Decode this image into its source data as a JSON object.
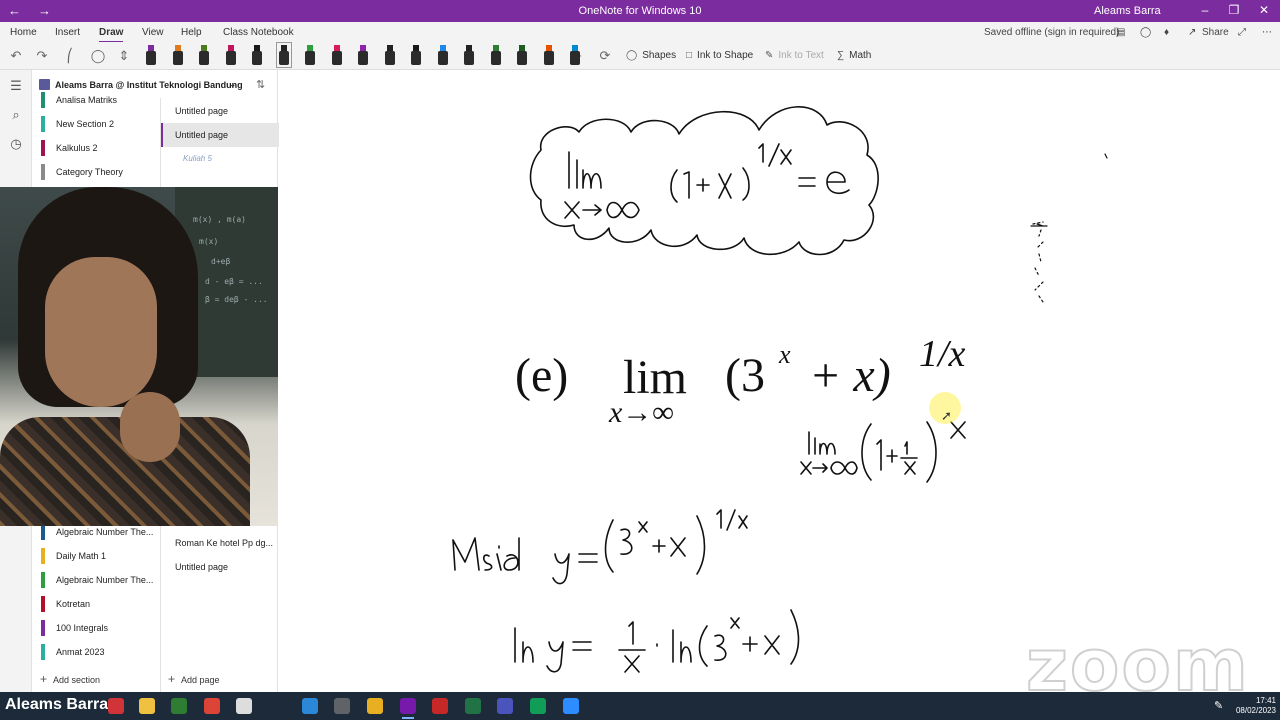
{
  "window": {
    "title": "OneNote for Windows 10",
    "user": "Aleams Barra",
    "back_icon": "arrow-left-icon",
    "forward_icon": "arrow-right-icon"
  },
  "menu": {
    "tabs": [
      "Home",
      "Insert",
      "Draw",
      "View",
      "Help",
      "Class Notebook"
    ],
    "active_tab": "Draw",
    "status": "Saved offline (sign in required)",
    "share": "Share"
  },
  "toolbar": {
    "shapes": "Shapes",
    "ink_to_shape": "Ink to Shape",
    "ink_to_text": "Ink to Text",
    "math": "Math",
    "pen_colors": [
      "#7b2c9e",
      "#e07a1f",
      "#4d7a1a",
      "#c2185b",
      "#1a1a1a",
      "#222222",
      "#2e9e3e",
      "#d81b60",
      "#8e24aa",
      "#222222",
      "#1a1a1a",
      "#1e88e5",
      "#222222",
      "#2e7d32",
      "#1b5e20",
      "#e65100",
      "#0288d1"
    ]
  },
  "notebook": {
    "name": "Aleams Barra @ Institut Teknologi Bandung",
    "sections_top": [
      {
        "label": "Analisa Matriks",
        "color": "#1f8f6e"
      },
      {
        "label": "New Section 2",
        "color": "#2bb0a0"
      },
      {
        "label": "Kalkulus 2",
        "color": "#a01450"
      },
      {
        "label": "Category Theory",
        "color": "#8a8a8a"
      }
    ],
    "sections_bottom": [
      {
        "label": "Algebraic Number The...",
        "color": "#1f5a8f"
      },
      {
        "label": "Daily Math 1",
        "color": "#e8b020"
      },
      {
        "label": "Algebraic Number The...",
        "color": "#2e9e3e"
      },
      {
        "label": "Kotretan",
        "color": "#b0102a"
      },
      {
        "label": "100 Integrals",
        "color": "#7b2c9e"
      },
      {
        "label": "Anmat 2023",
        "color": "#2bb0a0"
      }
    ],
    "pages_top": [
      "Untitled page",
      "Untitled page",
      "Kuliah 5"
    ],
    "pages_bottom": [
      "Roman Ke hotel Pp dg...",
      "Untitled page"
    ],
    "add_section": "Add section",
    "add_page": "Add page"
  },
  "canvas": {
    "problem_label": "(e)",
    "lim_word": "lim",
    "lim_sub": "x→∞",
    "base": "(3",
    "base_exp": "x",
    "plus_x": "+ x)",
    "outer_exp": "1/x",
    "watermark": "zoom"
  },
  "taskbar": {
    "user_label": "Aleams Barra",
    "time": "17:41",
    "date": "08/02/2023"
  }
}
